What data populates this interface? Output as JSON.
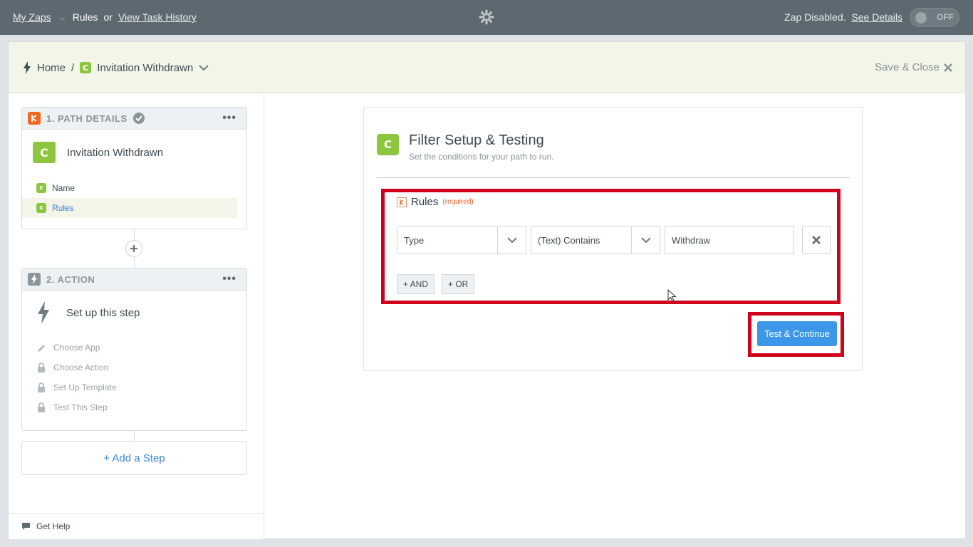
{
  "topbar": {
    "my_zaps": "My Zaps",
    "arrow": "→",
    "current": "Rules",
    "or": "or",
    "task_history": "View Task History",
    "status_text": "Zap Disabled.",
    "see_details": "See Details",
    "toggle_label": "OFF"
  },
  "header": {
    "home": "Home",
    "sep": "/",
    "app_badge": "C",
    "zap_name": "Invitation Withdrawn",
    "save_close": "Save & Close"
  },
  "sidebar": {
    "step1": {
      "header": "1. PATH DETAILS",
      "dots": "•••",
      "badge": "C",
      "title": "Invitation Withdrawn",
      "items": [
        {
          "badge": "c",
          "label": "Name"
        },
        {
          "badge": "c",
          "label": "Rules"
        }
      ]
    },
    "step2": {
      "header": "2. ACTION",
      "dots": "•••",
      "title": "Set up this step",
      "items": [
        {
          "label": "Choose App",
          "icon": "pencil-icon"
        },
        {
          "label": "Choose Action",
          "icon": "lock-icon"
        },
        {
          "label": "Set Up Template",
          "icon": "lock-icon"
        },
        {
          "label": "Test This Step",
          "icon": "lock-icon"
        }
      ]
    },
    "add_step": "+ Add a Step",
    "get_help": "Get Help"
  },
  "panel": {
    "badge": "C",
    "title": "Filter Setup & Testing",
    "subtitle": "Set the conditions for your path to run.",
    "rules_label": "Rules",
    "required": "(required)",
    "field": "Type",
    "condition": "(Text) Contains",
    "value": "Withdraw",
    "and_btn": "+ AND",
    "or_btn": "+ OR",
    "cta": "Test & Continue"
  },
  "colors": {
    "green": "#8cc63f",
    "orange": "#f26722",
    "blue": "#3d97e8",
    "highlight": "#d0021b"
  }
}
